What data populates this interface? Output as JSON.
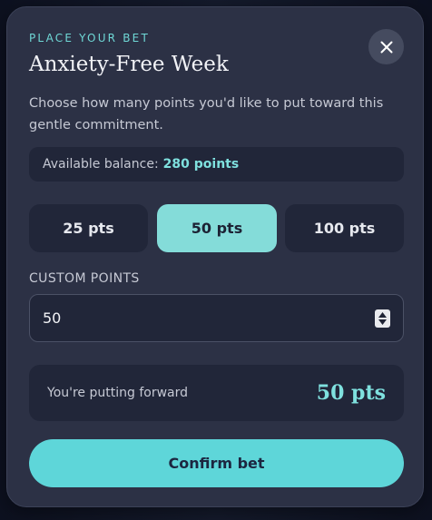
{
  "modal": {
    "eyebrow": "PLACE YOUR BET",
    "title": "Anxiety-Free Week",
    "subtitle": "Choose how many points you'd like to put toward this gentle commitment.",
    "close_icon": "close-icon"
  },
  "balance": {
    "label": "Available balance:",
    "amount": "280 points"
  },
  "presets": [
    {
      "label": "25 pts",
      "selected": false
    },
    {
      "label": "50 pts",
      "selected": true
    },
    {
      "label": "100 pts",
      "selected": false
    }
  ],
  "custom": {
    "label": "CUSTOM POINTS",
    "value": "50",
    "stepper_icon": "stepper-arrows-icon"
  },
  "summary": {
    "label": "You're putting forward",
    "total": "50 pts"
  },
  "confirm": {
    "label": "Confirm bet"
  },
  "colors": {
    "accent": "#5ed6d9",
    "selected_preset": "#84dcd9",
    "modal_bg": "#2c3145",
    "panel_bg": "#212639"
  }
}
